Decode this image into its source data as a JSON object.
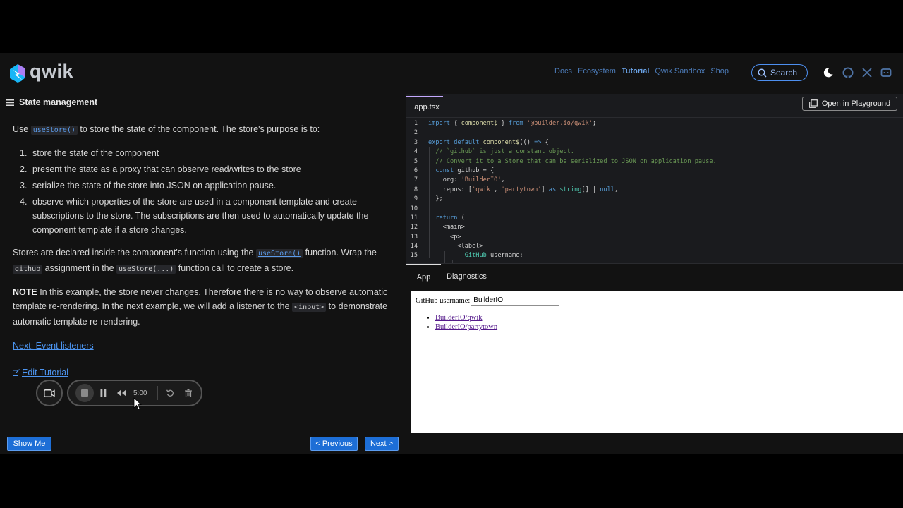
{
  "header": {
    "logo_text": "qwik",
    "nav": [
      "Docs",
      "Ecosystem",
      "Tutorial",
      "Qwik Sandbox",
      "Shop"
    ],
    "nav_active": "Tutorial",
    "search_label": "Search"
  },
  "lesson": {
    "title": "State management",
    "intro_pre": "Use ",
    "intro_code": "useStore()",
    "intro_post": " to store the state of the component. The store's purpose is to:",
    "steps": [
      {
        "num": "1.",
        "text": "store the state of the component"
      },
      {
        "num": "2.",
        "text": "present the state as a proxy that can observe read/writes to the store"
      },
      {
        "num": "3.",
        "text": "serialize the state of the store into JSON on application pause."
      },
      {
        "num": "4.",
        "text": "observe which properties of the store are used in a component template and create subscriptions to the store. The subscriptions are then used to automatically update the component template if a store changes."
      }
    ],
    "p2_a": "Stores are declared inside the component's function using the ",
    "p2_code1": "useStore()",
    "p2_b": " function. Wrap the ",
    "p2_code2": "github",
    "p2_c": " assignment in the ",
    "p2_code3": "useStore(...)",
    "p2_d": " function call to create a store.",
    "note_label": "NOTE",
    "note_a": " In this example, the store never changes. Therefore there is no way to observe automatic template re-rendering. In the next example, we will add a listener to the ",
    "note_code": "<input>",
    "note_b": " to demonstrate automatic template re-rendering.",
    "next_link": "Next: Event listeners",
    "edit_link": "Edit Tutorial"
  },
  "recorder": {
    "time": "5:00"
  },
  "buttons": {
    "show_me": "Show Me",
    "previous": "< Previous",
    "next": "Next >"
  },
  "editor": {
    "file_tab": "app.tsx",
    "open_playground": "Open in Playground",
    "line_numbers": [
      "1",
      "2",
      "3",
      "4",
      "5",
      "6",
      "7",
      "8",
      "9",
      "10",
      "11",
      "12",
      "13",
      "14",
      "15"
    ]
  },
  "preview": {
    "tabs": [
      "App",
      "Diagnostics"
    ],
    "label": "GitHub username:",
    "input_value": "BuilderIO",
    "repos": [
      "BuilderIO/qwik",
      "BuilderIO/partytown"
    ]
  },
  "colors": {
    "accent": "#1d6ed6",
    "tab_highlight": "#c5a9ff",
    "link": "#4d95f0"
  }
}
